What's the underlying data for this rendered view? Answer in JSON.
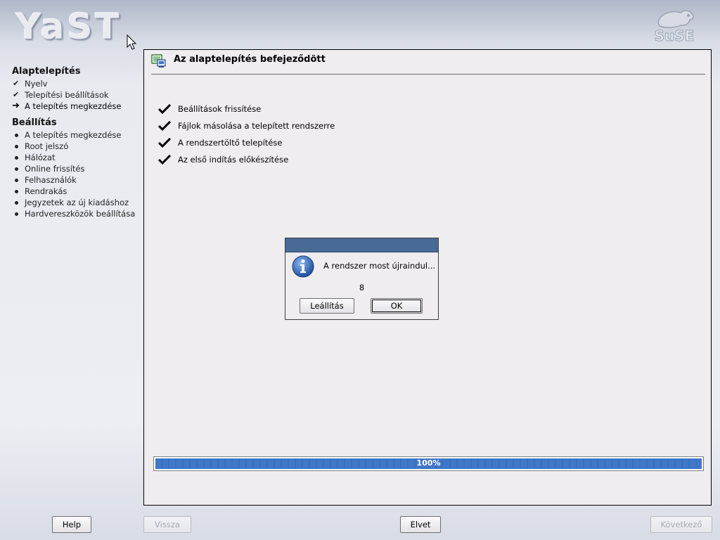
{
  "header": {
    "logo_text": "YaST",
    "brand_logo": "suse-logo"
  },
  "sidebar": {
    "sections": [
      {
        "title": "Alaptelepítés",
        "items": [
          {
            "label": "Nyelv",
            "state": "done"
          },
          {
            "label": "Telepítési beállítások",
            "state": "done"
          },
          {
            "label": "A telepítés megkezdése",
            "state": "current"
          }
        ]
      },
      {
        "title": "Beállítás",
        "items": [
          {
            "label": "A telepítés megkezdése",
            "state": "pending"
          },
          {
            "label": "Root jelszó",
            "state": "pending"
          },
          {
            "label": "Hálózat",
            "state": "pending"
          },
          {
            "label": "Online frissítés",
            "state": "pending"
          },
          {
            "label": "Felhasználók",
            "state": "pending"
          },
          {
            "label": "Rendrakás",
            "state": "pending"
          },
          {
            "label": "Jegyzetek az új kiadáshoz",
            "state": "pending"
          },
          {
            "label": "Hardvereszközök beállítása",
            "state": "pending"
          }
        ]
      }
    ]
  },
  "main": {
    "title": "Az alaptelepítés befejeződött",
    "steps": [
      "Beállítások frissítése",
      "Fájlok másolása a telepített rendszerre",
      "A rendszertöltő telepítése",
      "Az első indítás előkészítése"
    ],
    "progress": {
      "value_percent": 100,
      "label": "100%"
    }
  },
  "dialog": {
    "message": "A rendszer most újraindul...",
    "countdown": "8",
    "buttons": {
      "shutdown": "Leállítás",
      "ok": "OK"
    }
  },
  "bottom_bar": {
    "help": "Help",
    "back": "Vissza",
    "abort": "Elvet",
    "next": "Következő"
  },
  "colors": {
    "progress_fill": "#3f77c9",
    "dialog_titlebar": "#4a6a96",
    "panel_bg": "#efedf0"
  }
}
